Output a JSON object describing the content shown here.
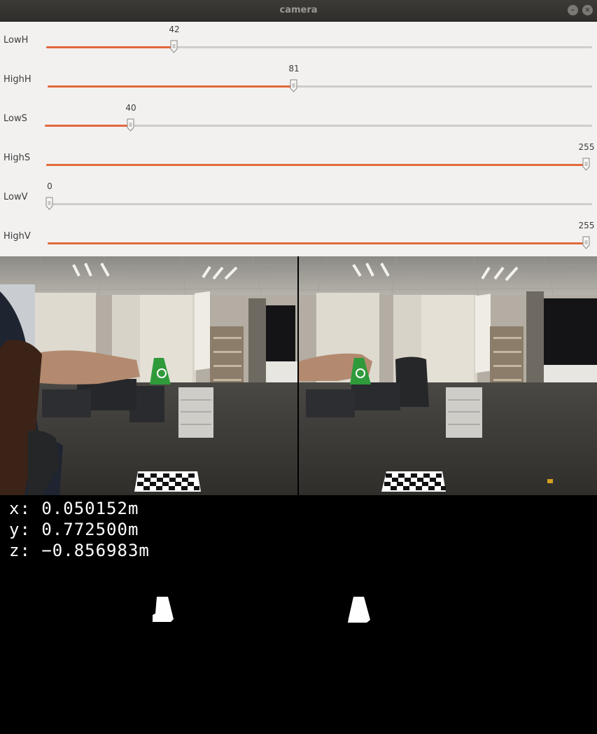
{
  "window": {
    "title": "camera"
  },
  "sliders": [
    {
      "label": "LowH",
      "value": 42,
      "max": 179
    },
    {
      "label": "HighH",
      "value": 81,
      "max": 179
    },
    {
      "label": "LowS",
      "value": 40,
      "max": 255
    },
    {
      "label": "HighS",
      "value": 255,
      "max": 255
    },
    {
      "label": "LowV",
      "value": 0,
      "max": 255
    },
    {
      "label": "HighV",
      "value": 255,
      "max": 255
    }
  ],
  "readout": {
    "x": "x: 0.050152m",
    "y": "y: 0.772500m",
    "z": "z: −0.856983m"
  },
  "colors": {
    "slider_fill": "#e2693c",
    "slider_track": "#cfcdca",
    "panel_bg": "#f2f1f0",
    "titlebar_bg": "#3c3b37",
    "marker_green": "#2e9a3a"
  },
  "icons": {
    "minimize": "minimize-icon",
    "maximize": "maximize-icon",
    "close": "close-icon"
  }
}
